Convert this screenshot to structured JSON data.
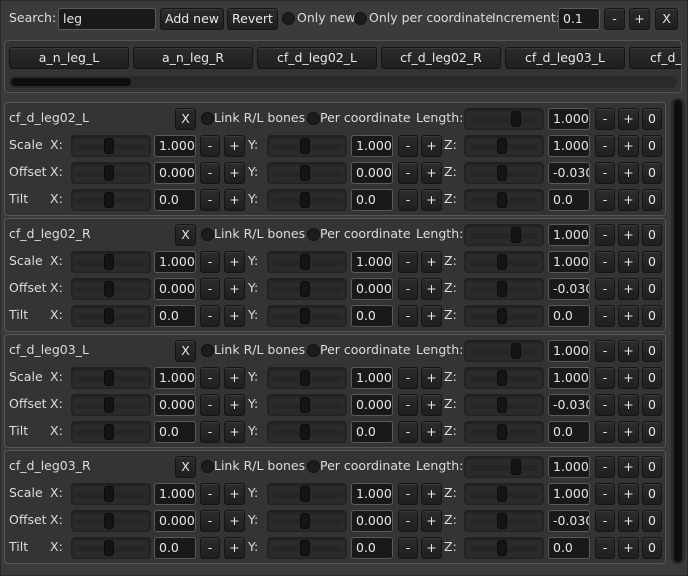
{
  "toolbar": {
    "search_label": "Search:",
    "search_value": "leg",
    "add_new_label": "Add new",
    "revert_label": "Revert",
    "only_new_label": "Only new",
    "only_per_coord_label": "Only per coordinate",
    "increment_label": "Increment:",
    "increment_value": "0.1",
    "minus_label": "-",
    "plus_label": "+",
    "close_label": "X"
  },
  "bone_tabs": [
    "a_n_leg_L",
    "a_n_leg_R",
    "cf_d_leg02_L",
    "cf_d_leg02_R",
    "cf_d_leg03_L",
    "cf_d_le"
  ],
  "row_labels": {
    "scale": "Scale",
    "offset": "Offset",
    "tilt": "Tilt",
    "x": "X:",
    "y": "Y:",
    "z": "Z:",
    "length": "Length:",
    "link": "Link R/L bones",
    "per_coord": "Per coordinate",
    "close": "X",
    "minus": "-",
    "plus": "+",
    "zero": "0"
  },
  "bones": [
    {
      "name": "cf_d_leg02_L",
      "length": "1.000",
      "scale": [
        "1.000",
        "1.000",
        "1.000"
      ],
      "offset": [
        "0.000",
        "0.000",
        "-0.030"
      ],
      "tilt": [
        "0.0",
        "0.0",
        "0.0"
      ]
    },
    {
      "name": "cf_d_leg02_R",
      "length": "1.000",
      "scale": [
        "1.000",
        "1.000",
        "1.000"
      ],
      "offset": [
        "0.000",
        "0.000",
        "-0.030"
      ],
      "tilt": [
        "0.0",
        "0.0",
        "0.0"
      ]
    },
    {
      "name": "cf_d_leg03_L",
      "length": "1.000",
      "scale": [
        "1.000",
        "1.000",
        "1.000"
      ],
      "offset": [
        "0.000",
        "0.000",
        "-0.030"
      ],
      "tilt": [
        "0.0",
        "0.0",
        "0.0"
      ]
    },
    {
      "name": "cf_d_leg03_R",
      "length": "1.000",
      "scale": [
        "1.000",
        "1.000",
        "1.000"
      ],
      "offset": [
        "0.000",
        "0.000",
        "-0.030"
      ],
      "tilt": [
        "0.0",
        "0.0",
        "0.0"
      ]
    }
  ]
}
